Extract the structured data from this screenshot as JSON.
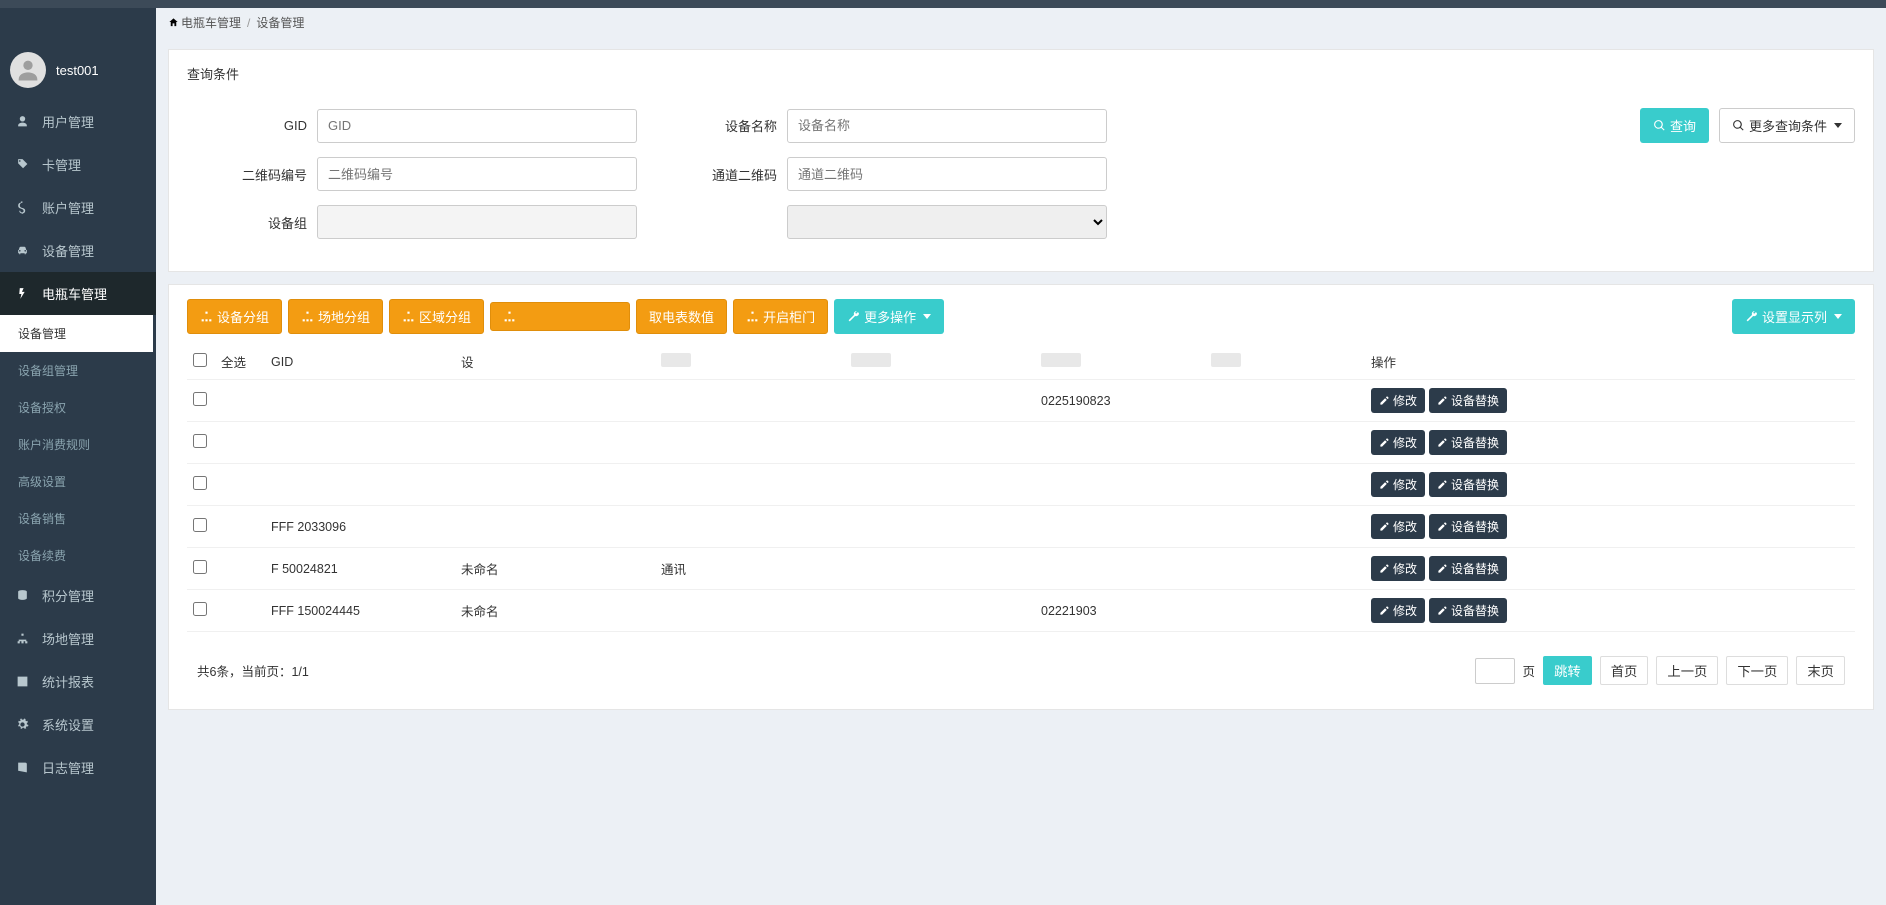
{
  "user": {
    "name": "test001"
  },
  "breadcrumb": {
    "parent": "电瓶车管理",
    "current": "设备管理"
  },
  "nav": {
    "users": "用户管理",
    "card": "卡管理",
    "account": "账户管理",
    "device": "设备管理",
    "ebike": "电瓶车管理",
    "points": "积分管理",
    "site": "场地管理",
    "stats": "统计报表",
    "system": "系统设置",
    "log": "日志管理"
  },
  "subnav": {
    "device_mgmt": "设备管理",
    "device_group_mgmt": "设备组管理",
    "device_auth": "设备授权",
    "account_rule": "账户消费规则",
    "adv_settings": "高级设置",
    "device_sale": "设备销售",
    "device_renew": "设备续费"
  },
  "search": {
    "panel_title": "查询条件",
    "gid_label": "GID",
    "gid_placeholder": "GID",
    "device_name_label": "设备名称",
    "device_name_placeholder": "设备名称",
    "qr_label": "二维码编号",
    "qr_placeholder": "二维码编号",
    "channel_qr_label": "通道二维码",
    "channel_qr_placeholder": "通道二维码",
    "device_group_label": "设备组",
    "query_btn": "查询",
    "more_cond_btn": "更多查询条件"
  },
  "toolbar": {
    "dev_group": "设备分组",
    "site_group": "场地分组",
    "area_group": "区域分组",
    "redacted": " ",
    "get_meter": "取电表数值",
    "open_cabinet": "开启柜门",
    "more_ops": "更多操作",
    "display_cols": "设置显示列"
  },
  "table": {
    "select_all": "全选",
    "col_gid": "GID",
    "col_device": "设",
    "col_ops": "操作",
    "edit": "修改",
    "replace": "设备替换",
    "rows": [
      {
        "gid": "",
        "col3": "",
        "col4": "",
        "col5": "0225190823"
      },
      {
        "gid": "",
        "col3": "",
        "col4": "",
        "col5": ""
      },
      {
        "gid": "",
        "col3": "",
        "col4": "",
        "col5": ""
      },
      {
        "gid": "FFF      2033096",
        "col3": "",
        "col4": "",
        "col5": ""
      },
      {
        "gid": "F        50024821",
        "col3": "未命名",
        "col4": "通讯",
        "col5": ""
      },
      {
        "gid": "FFF   150024445",
        "col3": "未命名",
        "col4": "",
        "col5": "02221903"
      }
    ]
  },
  "pager": {
    "summary": "共6条，当前页：1/1",
    "page_sfx": "页",
    "jump": "跳转",
    "first": "首页",
    "prev": "上一页",
    "next": "下一页",
    "last": "末页"
  }
}
